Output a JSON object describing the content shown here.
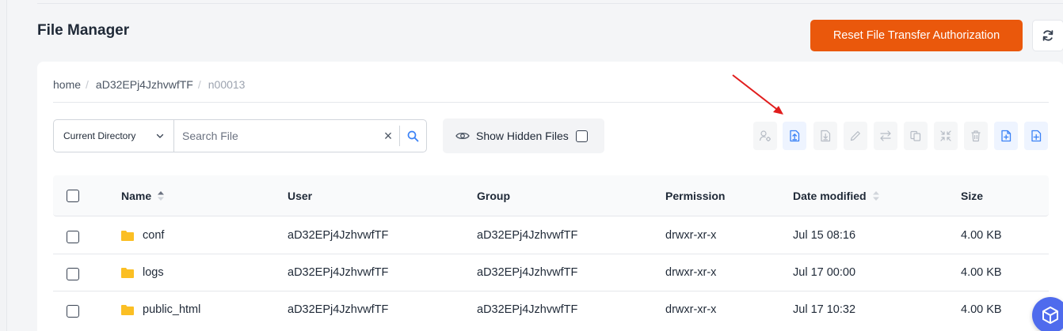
{
  "page": {
    "title": "File Manager"
  },
  "actions": {
    "reset_label": "Reset File Transfer Authorization"
  },
  "breadcrumb": [
    "home",
    "aD32EPj4JzhvwfTF",
    "n00013"
  ],
  "search": {
    "directory_scope": "Current Directory",
    "placeholder": "Search File",
    "value": ""
  },
  "hidden_files": {
    "label": "Show Hidden Files",
    "checked": false
  },
  "toolbar": {
    "icons": [
      "user-permissions-icon",
      "upload-file-icon",
      "download-file-icon",
      "rename-icon",
      "move-icon",
      "copy-icon",
      "compress-icon",
      "delete-icon",
      "new-file-icon",
      "new-folder-icon"
    ]
  },
  "table": {
    "columns": [
      "Name",
      "User",
      "Group",
      "Permission",
      "Date modified",
      "Size"
    ],
    "rows": [
      {
        "name": "conf",
        "user": "aD32EPj4JzhvwfTF",
        "group": "aD32EPj4JzhvwfTF",
        "permission": "drwxr-xr-x",
        "modified": "Jul 15 08:16",
        "size": "4.00 KB"
      },
      {
        "name": "logs",
        "user": "aD32EPj4JzhvwfTF",
        "group": "aD32EPj4JzhvwfTF",
        "permission": "drwxr-xr-x",
        "modified": "Jul 17 00:00",
        "size": "4.00 KB"
      },
      {
        "name": "public_html",
        "user": "aD32EPj4JzhvwfTF",
        "group": "aD32EPj4JzhvwfTF",
        "permission": "drwxr-xr-x",
        "modified": "Jul 17 10:32",
        "size": "4.00 KB"
      }
    ]
  },
  "colors": {
    "accent": "#ea580c",
    "link": "#3b82f6",
    "folder": "#fbbf24",
    "annotation": "#e11d1d"
  }
}
